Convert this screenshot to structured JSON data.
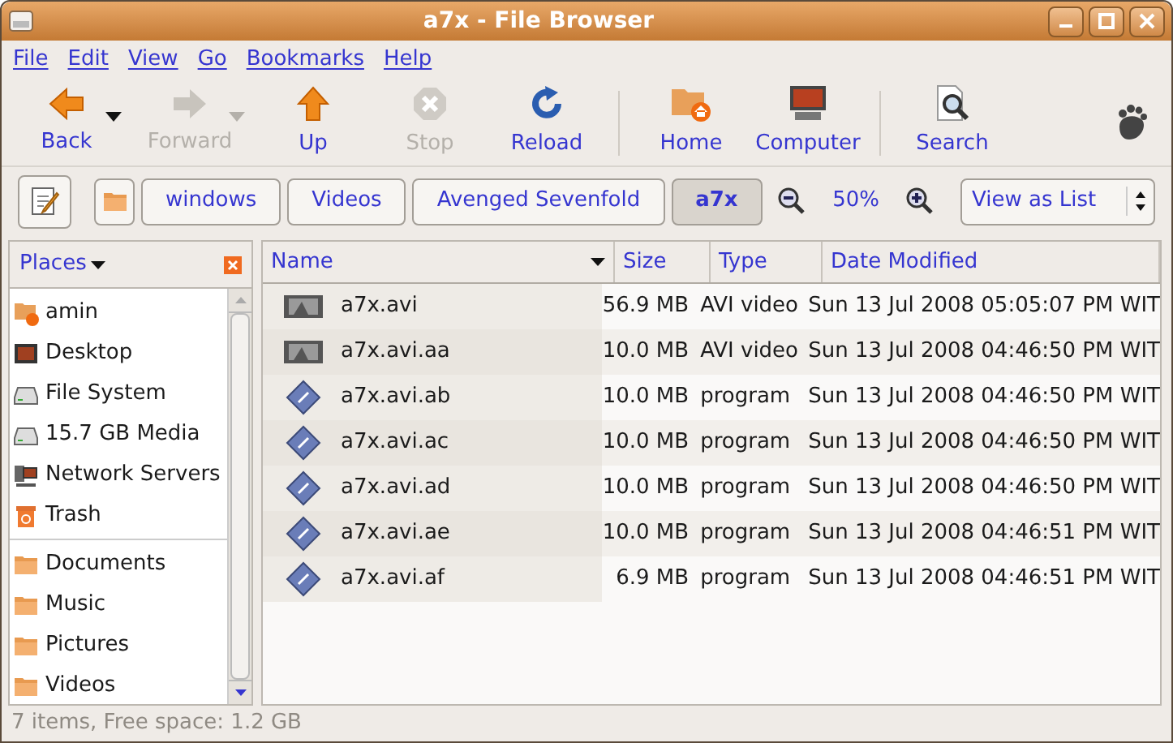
{
  "window": {
    "title": "a7x - File Browser"
  },
  "menu": [
    "File",
    "Edit",
    "View",
    "Go",
    "Bookmarks",
    "Help"
  ],
  "toolbar": [
    {
      "kind": "back",
      "label": "Back",
      "disabled": false,
      "dropdown": true
    },
    {
      "kind": "forward",
      "label": "Forward",
      "disabled": true,
      "dropdown": true
    },
    {
      "kind": "up",
      "label": "Up",
      "disabled": false,
      "dropdown": false
    },
    {
      "kind": "stop",
      "label": "Stop",
      "disabled": true,
      "dropdown": false
    },
    {
      "kind": "reload",
      "label": "Reload",
      "disabled": false,
      "dropdown": false
    },
    {
      "kind": "separator"
    },
    {
      "kind": "home",
      "label": "Home",
      "disabled": false,
      "dropdown": false
    },
    {
      "kind": "computer",
      "label": "Computer",
      "disabled": false,
      "dropdown": false
    },
    {
      "kind": "separator"
    },
    {
      "kind": "search",
      "label": "Search",
      "disabled": false,
      "dropdown": false
    }
  ],
  "path": [
    {
      "label": "windows",
      "selected": false
    },
    {
      "label": "Videos",
      "selected": false
    },
    {
      "label": "Avenged Sevenfold",
      "selected": false
    },
    {
      "label": "a7x",
      "selected": true
    }
  ],
  "zoom": {
    "value": "50%"
  },
  "view_select": {
    "value": "View as List"
  },
  "sidebar": {
    "title": "Places",
    "sections": [
      [
        {
          "kind": "home",
          "label": "amin"
        },
        {
          "kind": "desktop",
          "label": "Desktop"
        },
        {
          "kind": "drive",
          "label": "File System"
        },
        {
          "kind": "drive",
          "label": "15.7 GB Media"
        },
        {
          "kind": "network",
          "label": "Network Servers"
        },
        {
          "kind": "trash",
          "label": "Trash"
        }
      ],
      [
        {
          "kind": "folder",
          "label": "Documents"
        },
        {
          "kind": "folder",
          "label": "Music"
        },
        {
          "kind": "folder",
          "label": "Pictures"
        },
        {
          "kind": "folder",
          "label": "Videos"
        }
      ]
    ]
  },
  "table": {
    "columns": [
      "Name",
      "Size",
      "Type",
      "Date Modified"
    ],
    "rows": [
      {
        "kind": "video",
        "name": "a7x.avi",
        "size": "56.9 MB",
        "type": "AVI video",
        "date": "Sun 13 Jul 2008 05:05:07 PM WIT"
      },
      {
        "kind": "video",
        "name": "a7x.avi.aa",
        "size": "10.0 MB",
        "type": "AVI video",
        "date": "Sun 13 Jul 2008 04:46:50 PM WIT"
      },
      {
        "kind": "program",
        "name": "a7x.avi.ab",
        "size": "10.0 MB",
        "type": "program",
        "date": "Sun 13 Jul 2008 04:46:50 PM WIT"
      },
      {
        "kind": "program",
        "name": "a7x.avi.ac",
        "size": "10.0 MB",
        "type": "program",
        "date": "Sun 13 Jul 2008 04:46:50 PM WIT"
      },
      {
        "kind": "program",
        "name": "a7x.avi.ad",
        "size": "10.0 MB",
        "type": "program",
        "date": "Sun 13 Jul 2008 04:46:50 PM WIT"
      },
      {
        "kind": "program",
        "name": "a7x.avi.ae",
        "size": "10.0 MB",
        "type": "program",
        "date": "Sun 13 Jul 2008 04:46:51 PM WIT"
      },
      {
        "kind": "program",
        "name": "a7x.avi.af",
        "size": "6.9 MB",
        "type": "program",
        "date": "Sun 13 Jul 2008 04:46:51 PM WIT"
      }
    ]
  },
  "status_bar": "7 items, Free space: 1.2 GB"
}
